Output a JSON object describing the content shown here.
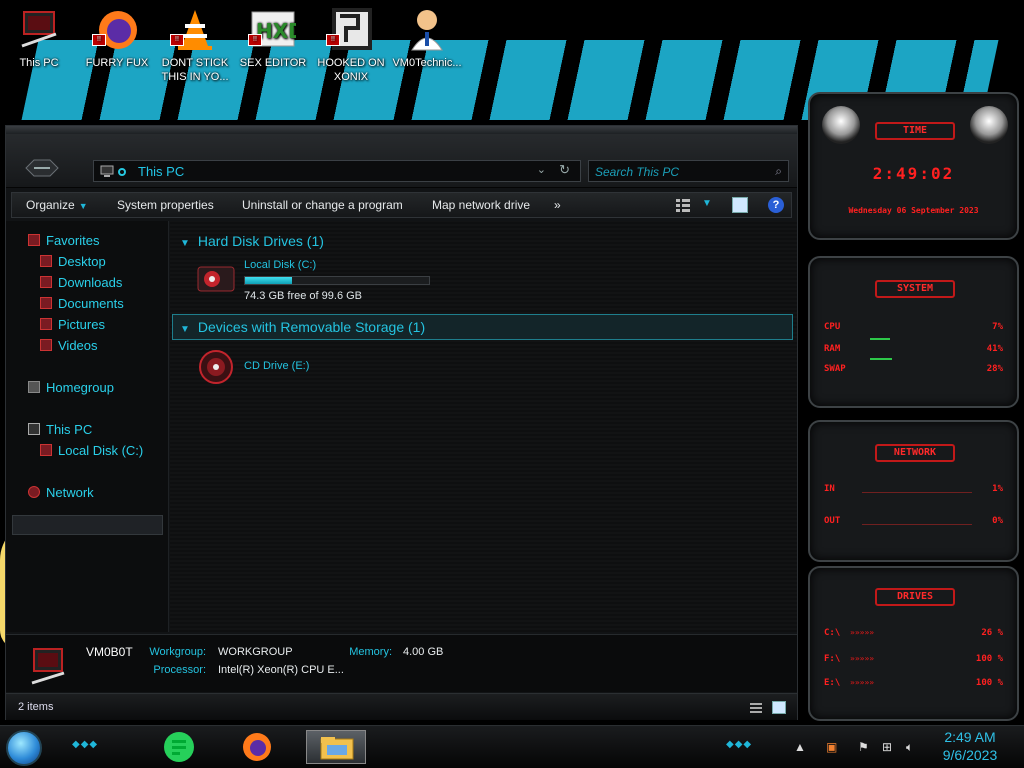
{
  "desktop": {
    "icons": [
      {
        "label": "This PC"
      },
      {
        "label": "FURRY FUX"
      },
      {
        "label": "DONT STICK THIS IN YO..."
      },
      {
        "label": "SEX EDITOR"
      },
      {
        "label": "HOOKED ON XONIX"
      },
      {
        "label": "VM0Technic..."
      }
    ]
  },
  "explorer": {
    "address": "This PC",
    "search_placeholder": "Search This PC",
    "commands": {
      "organize": "Organize",
      "system_properties": "System properties",
      "uninstall": "Uninstall or change a program",
      "map_drive": "Map network drive",
      "more": "»"
    },
    "nav": {
      "favorites": "Favorites",
      "desktop": "Desktop",
      "downloads": "Downloads",
      "documents": "Documents",
      "pictures": "Pictures",
      "videos": "Videos",
      "homegroup": "Homegroup",
      "this_pc": "This PC",
      "local_disk": "Local Disk (C:)",
      "network": "Network"
    },
    "groups": {
      "hdd": "Hard Disk Drives (1)",
      "removable": "Devices with Removable Storage (1)"
    },
    "drives": {
      "c_name": "Local Disk (C:)",
      "c_free": "74.3 GB free of 99.6 GB",
      "c_used_fraction": 0.254,
      "e_name": "CD Drive (E:)"
    },
    "details": {
      "computer_name": "VM0B0T",
      "workgroup_label": "Workgroup:",
      "workgroup": "WORKGROUP",
      "memory_label": "Memory:",
      "memory": "4.00 GB",
      "processor_label": "Processor:",
      "processor": "Intel(R) Xeon(R) CPU E..."
    },
    "status": "2 items"
  },
  "gadgets": {
    "time": {
      "title": "TIME",
      "clock": "2:49:02",
      "date": "Wednesday 06 September 2023"
    },
    "system": {
      "title": "SYSTEM",
      "cpu_label": "CPU",
      "cpu": "7%",
      "ram_label": "RAM",
      "ram": "41%",
      "swap_label": "SWAP",
      "swap": "28%"
    },
    "network": {
      "title": "NETWORK",
      "in_label": "IN",
      "in": "1%",
      "out_label": "OUT",
      "out": "0%"
    },
    "drives": {
      "title": "DRIVES",
      "d1_label": "C:\\",
      "d1": "26 %",
      "d2_label": "F:\\",
      "d2": "100 %",
      "d3_label": "E:\\",
      "d3": "100 %"
    }
  },
  "taskbar": {
    "time": "2:49 AM",
    "date": "9/6/2023"
  },
  "colors": {
    "accent": "#1fb7d9",
    "gadget_red": "#ff2020"
  }
}
